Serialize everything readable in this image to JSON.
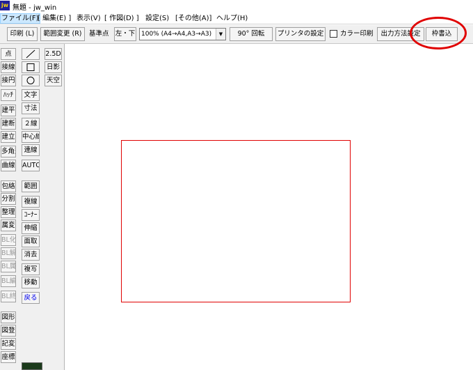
{
  "window": {
    "title": "無題 - jw_win",
    "icon_label": "jw"
  },
  "menu": [
    {
      "label": "ファイル(F)",
      "active": true
    },
    {
      "label": "[ 編集(E) ]"
    },
    {
      "label": "表示(V)"
    },
    {
      "label": "[ 作図(D) ]"
    },
    {
      "label": "設定(S)"
    },
    {
      "label": "[その他(A)]"
    },
    {
      "label": "ヘルプ(H)"
    }
  ],
  "toolbar": {
    "print": "印刷 (L)",
    "range_change": "範囲変更 (R)",
    "base_point_label": "基準点",
    "base_point_value": "左・下",
    "scale_select": "100% (A4→A4,A3→A3)",
    "rotate": "90° 回転",
    "printer_settings": "プリンタの設定",
    "color_print": "カラー印刷",
    "output_method": "出力方法設定",
    "frame_write": "枠書込"
  },
  "left_tools": {
    "col1": [
      {
        "label": "点"
      },
      {
        "label": "接線"
      },
      {
        "label": "接円"
      },
      {
        "label": "ﾊｯﾁ"
      },
      {
        "label": "建平"
      },
      {
        "label": "建断"
      },
      {
        "label": "建立"
      },
      {
        "label": "多角形"
      },
      {
        "label": "曲線"
      },
      {
        "label": "包絡"
      },
      {
        "label": "分割"
      },
      {
        "label": "整理"
      },
      {
        "label": "属変"
      },
      {
        "label": "BL化",
        "disabled": true
      },
      {
        "label": "BL解",
        "disabled": true
      },
      {
        "label": "BL属",
        "disabled": true
      },
      {
        "label": "BL編",
        "disabled": true
      },
      {
        "label": "BL終",
        "disabled": true
      },
      {
        "label": "図形"
      },
      {
        "label": "図登"
      },
      {
        "label": "記変"
      },
      {
        "label": "座標"
      }
    ],
    "col2": [
      {
        "icon": "line-icon"
      },
      {
        "icon": "rectangle-icon"
      },
      {
        "icon": "circle-icon"
      },
      {
        "label": "文字"
      },
      {
        "label": "寸法"
      },
      {
        "label": "２線"
      },
      {
        "label": "中心線"
      },
      {
        "label": "連線"
      },
      {
        "label": "AUTO"
      },
      {
        "label": "範囲"
      },
      {
        "label": "複線"
      },
      {
        "label": "ｺｰﾅｰ"
      },
      {
        "label": "伸縮"
      },
      {
        "label": "面取"
      },
      {
        "label": "消去"
      },
      {
        "label": "複写"
      },
      {
        "label": "移動"
      },
      {
        "label": "戻る",
        "blue": true
      }
    ],
    "col3": [
      {
        "label": "2.5D"
      },
      {
        "label": "日影"
      },
      {
        "label": "天空"
      }
    ]
  },
  "colors": {
    "paper_frame": "#e00000",
    "annotation_circle": "#e00000"
  }
}
